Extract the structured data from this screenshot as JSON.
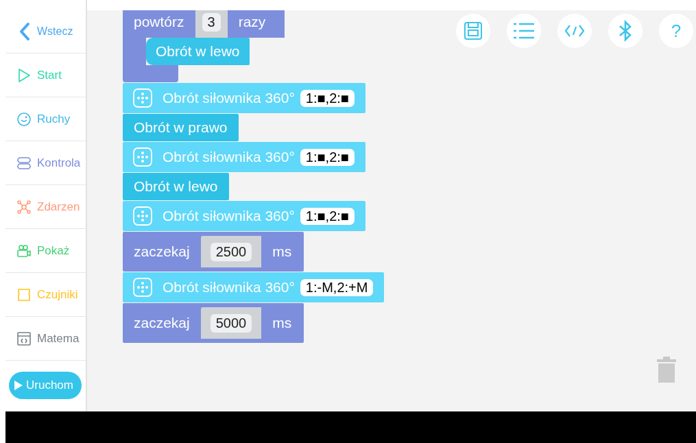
{
  "sidebar": {
    "back": {
      "label": "Wstecz"
    },
    "items": [
      {
        "label": "Start",
        "color": "#2ed8ae"
      },
      {
        "label": "Ruchy",
        "color": "#3cb9e8"
      },
      {
        "label": "Kontrola",
        "color": "#7d8fdc"
      },
      {
        "label": "Zdarzen",
        "color": "#ff9b7b"
      },
      {
        "label": "Pokaż",
        "color": "#45d075"
      },
      {
        "label": "Czujniki",
        "color": "#ffc21f"
      },
      {
        "label": "Matema",
        "color": "#7a8087"
      }
    ],
    "run_button": {
      "label": "Uruchom"
    }
  },
  "toolbar": {
    "help_label": "?"
  },
  "blocks": [
    {
      "kind": "repeat",
      "label": "powtórz",
      "value": "3",
      "suffix": "razy",
      "children": [
        {
          "kind": "turn",
          "label": "Obrót w lewo"
        }
      ]
    },
    {
      "kind": "servo",
      "label": "Obrót siłownika 360°",
      "value": "1:■,2:■"
    },
    {
      "kind": "turn",
      "label": "Obrót w prawo"
    },
    {
      "kind": "servo",
      "label": "Obrót siłownika 360°",
      "value": "1:■,2:■"
    },
    {
      "kind": "turn",
      "label": "Obrót w lewo"
    },
    {
      "kind": "servo",
      "label": "Obrót siłownika 360°",
      "value": "1:■,2:■"
    },
    {
      "kind": "wait",
      "label": "zaczekaj",
      "value": "2500",
      "unit": "ms"
    },
    {
      "kind": "servo",
      "label": "Obrót siłownika 360°",
      "value": "1:-M,2:+M"
    },
    {
      "kind": "wait",
      "label": "zaczekaj",
      "value": "5000",
      "unit": "ms"
    }
  ]
}
